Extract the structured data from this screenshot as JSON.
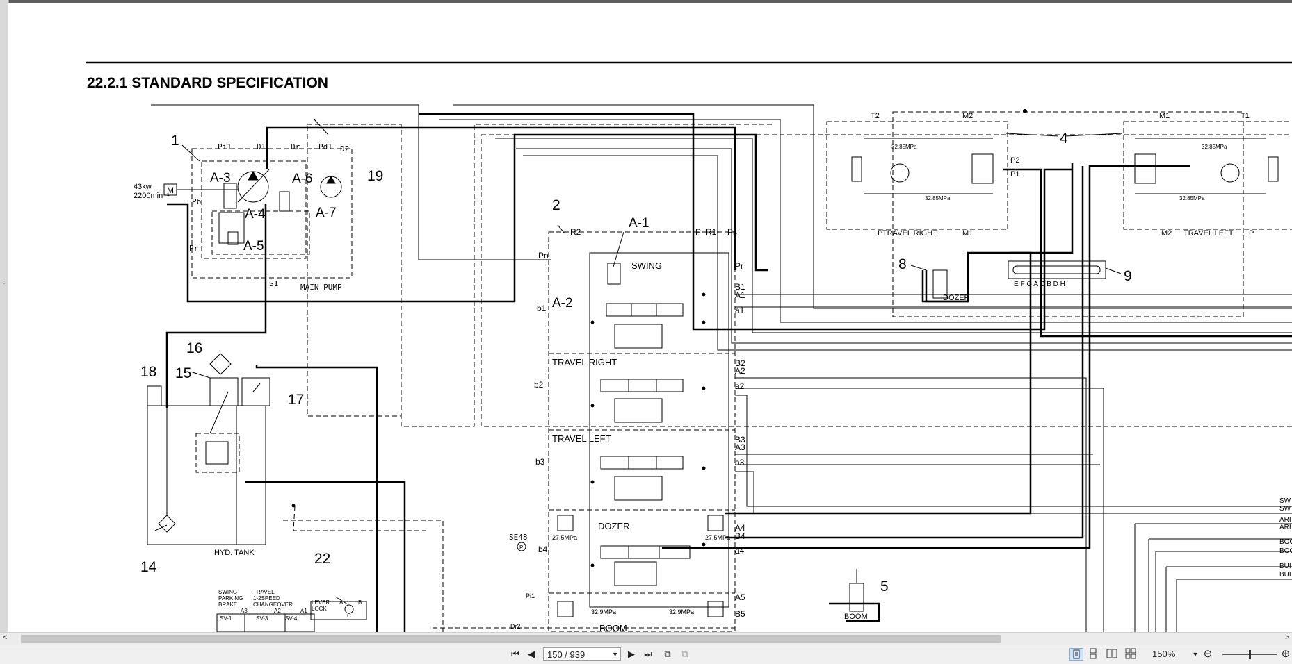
{
  "document": {
    "section_title": "22.2.1   STANDARD SPECIFICATION",
    "callouts": [
      "1",
      "2",
      "4",
      "5",
      "8",
      "9",
      "14",
      "15",
      "16",
      "17",
      "18",
      "19",
      "22"
    ],
    "pump": {
      "label": "MAIN PUMP",
      "power": "43kw",
      "speed": "2200min⁻¹",
      "motor_mark": "M",
      "ports": [
        "Pi1",
        "D1",
        "Dr",
        "Pd1",
        "D2",
        "Pb",
        "Pr",
        "S1"
      ],
      "sub_labels": [
        "A-3",
        "A-4",
        "A-5",
        "A-6",
        "A-7"
      ]
    },
    "valve": {
      "ports_top": [
        "R2",
        "P",
        "R1",
        "Ps"
      ],
      "ports_left": [
        "Pn",
        "b1",
        "b2",
        "b3",
        "b4"
      ],
      "ports_right": [
        "Pr",
        "B1",
        "A1",
        "a1",
        "B2",
        "A2",
        "a2",
        "B3",
        "A3",
        "a3",
        "A4",
        "B4",
        "a4",
        "A5",
        "B5"
      ],
      "sub_labels": [
        "A-1",
        "A-2"
      ],
      "sections": [
        "SWING",
        "TRAVEL RIGHT",
        "TRAVEL LEFT",
        "DOZER",
        "BOOM"
      ],
      "pressures": [
        "27.5MPa",
        "27.5MPa",
        "32.9MPa",
        "32.9MPa"
      ],
      "sensor": "SE48",
      "sensor_mark": "P",
      "pi_label": "Pi1",
      "dr_label": "Dr2"
    },
    "travel": {
      "right_label": "TRAVEL RIGHT",
      "left_label": "TRAVEL LEFT",
      "pressure": "32.85MPa",
      "ports": [
        "T2",
        "M2",
        "P2",
        "P1",
        "M1",
        "T1"
      ],
      "m1": "M1",
      "m2": "M2",
      "p_label": "P"
    },
    "dozer_label": "DOZER",
    "boom_label": "BOOM",
    "swivel_ports": "E F G A C B D H",
    "tank_label": "HYD. TANK",
    "solenoids": {
      "swing_brake": "SWING\nPARKING\nBRAKE",
      "travel_speed": "TRAVEL\n1-2SPEED\nCHANGEOVER",
      "lever_lock": "LEVER\nLOCK",
      "valves": [
        "SV-1",
        "SV-3",
        "SV-4"
      ],
      "ports": [
        "A3",
        "A2",
        "A1"
      ],
      "lock_ports": [
        "A",
        "B",
        "C"
      ]
    },
    "right_edge_labels": [
      "SW",
      "SW",
      "ARI",
      "ARI",
      "BOO",
      "BOO",
      "BUI",
      "BUI"
    ]
  },
  "toolbar": {
    "page_indicator": "150 / 939",
    "zoom": "150%",
    "first_icon": "first-page-icon",
    "prev_icon": "prev-page-icon",
    "next_icon": "next-page-icon",
    "last_icon": "last-page-icon"
  }
}
